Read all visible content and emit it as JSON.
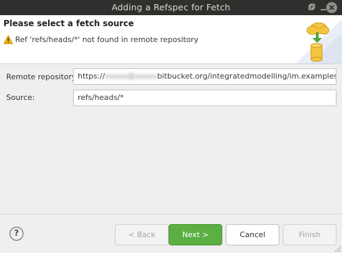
{
  "window": {
    "title": "Adding a Refspec for Fetch",
    "controls": {
      "restore_icon": "restore-icon",
      "minimize_icon": "minimize-icon",
      "close_icon": "close-icon"
    }
  },
  "header": {
    "title": "Please select a fetch source",
    "message": "Ref 'refs/heads/*' not found in remote repository",
    "message_icon": "warning-icon",
    "graphic_icon": "cloud-database-fetch-icon"
  },
  "form": {
    "remote_repository": {
      "label": "Remote repository:",
      "value_prefix": "https://",
      "value_obscured": "xxxxx@xxxxx",
      "value_suffix": "bitbucket.org/integratedmodelling/im.examples.git"
    },
    "source": {
      "label": "Source:",
      "value": "refs/heads/*"
    }
  },
  "footer": {
    "help_label": "?",
    "buttons": {
      "back": "< Back",
      "next": "Next >",
      "cancel": "Cancel",
      "finish": "Finish"
    }
  },
  "colors": {
    "titlebar": "#2f2f2d",
    "primary_button": "#5caf42",
    "warning": "#f2b400"
  }
}
